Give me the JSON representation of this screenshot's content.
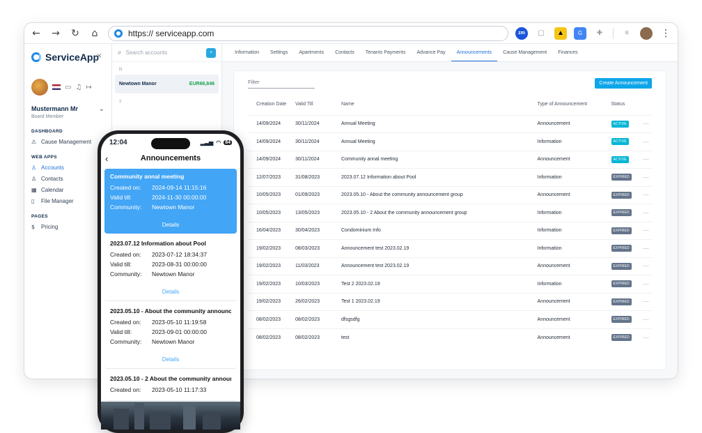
{
  "browser": {
    "url": "https:// serviceapp.com",
    "nav": {
      "back": "←",
      "forward": "→",
      "reload": "↻",
      "home": "⌂"
    }
  },
  "sidebar": {
    "brand": "ServiceApp",
    "close": "×",
    "user": {
      "name": "Mustermann Mr",
      "role": "Board Member"
    },
    "sections": [
      {
        "title": "DASHBOARD",
        "items": [
          {
            "label": "Cause Management",
            "icon": "warning-icon",
            "glyph": "⚠"
          }
        ]
      },
      {
        "title": "WEB APPS",
        "items": [
          {
            "label": "Accounts",
            "icon": "user-icon",
            "glyph": "♙"
          },
          {
            "label": "Contacts",
            "icon": "users-icon",
            "glyph": "♙"
          },
          {
            "label": "Calendar",
            "icon": "calendar-icon",
            "glyph": "▦"
          },
          {
            "label": "File Manager",
            "icon": "file-icon",
            "glyph": "▯"
          }
        ]
      },
      {
        "title": "PAGES",
        "items": [
          {
            "label": "Pricing",
            "icon": "dollar-icon",
            "glyph": "$"
          }
        ]
      }
    ]
  },
  "accounts": {
    "search_placeholder": "Search accounts",
    "letter_n": "N",
    "letter_t": "T",
    "items": [
      {
        "name": "Newtown Manor",
        "amount": "EUR66,846"
      }
    ]
  },
  "tabs": [
    "Information",
    "Settings",
    "Apartments",
    "Contacts",
    "Tenants Payments",
    "Advance Pay",
    "Announcements",
    "Cause Management",
    "Finances"
  ],
  "active_tab": "Announcements",
  "panel": {
    "filter_label": "Filter",
    "create_button": "Create Announcement",
    "columns": [
      "Creation Date",
      "Valid Till",
      "Name",
      "Type of Announcement",
      "Status"
    ],
    "rows": [
      {
        "created": "14/09/2024",
        "valid": "30/11/2024",
        "name": "Annual Meeting",
        "type": "Announcement",
        "status": "ACTIVE"
      },
      {
        "created": "14/09/2024",
        "valid": "30/11/2024",
        "name": "Annual Meeting",
        "type": "Information",
        "status": "ACTIVE"
      },
      {
        "created": "14/09/2024",
        "valid": "30/11/2024",
        "name": "Community annal meeting",
        "type": "Announcement",
        "status": "ACTIVE"
      },
      {
        "created": "12/07/2023",
        "valid": "31/08/2023",
        "name": "2023.07.12 Information about Pool",
        "type": "Information",
        "status": "EXPIRED"
      },
      {
        "created": "10/05/2023",
        "valid": "01/09/2023",
        "name": "2023.05.10 - About the community announcement group",
        "type": "Announcement",
        "status": "EXPIRED"
      },
      {
        "created": "10/05/2023",
        "valid": "13/05/2023",
        "name": "2023.05.10 - 2 About the community announcement group",
        "type": "Information",
        "status": "EXPIRED"
      },
      {
        "created": "16/04/2023",
        "valid": "30/04/2023",
        "name": "Condominium Info",
        "type": "Information",
        "status": "EXPIRED"
      },
      {
        "created": "19/02/2023",
        "valid": "08/03/2023",
        "name": "Announcement test 2023.02.19",
        "type": "Information",
        "status": "EXPIRED"
      },
      {
        "created": "19/02/2023",
        "valid": "11/03/2023",
        "name": "Announcement test 2023.02.19",
        "type": "Announcement",
        "status": "EXPIRED"
      },
      {
        "created": "19/02/2023",
        "valid": "10/03/2023",
        "name": "Test 2 2023.02.19",
        "type": "Information",
        "status": "EXPIRED"
      },
      {
        "created": "19/02/2023",
        "valid": "26/02/2023",
        "name": "Test 1 2023.02.19",
        "type": "Announcement",
        "status": "EXPIRED"
      },
      {
        "created": "08/02/2023",
        "valid": "08/02/2023",
        "name": "dfsgsdfg",
        "type": "Announcement",
        "status": "EXPIRED"
      },
      {
        "created": "08/02/2023",
        "valid": "08/02/2023",
        "name": "test",
        "type": "Announcement",
        "status": "EXPIRED"
      }
    ],
    "more": "···"
  },
  "phone": {
    "time": "12:04",
    "battery": "84",
    "title": "Announcements",
    "labels": {
      "created": "Created on:",
      "valid": "Valid till:",
      "community": "Community:",
      "details": "Details"
    },
    "cards": [
      {
        "title": "Community annal meeting",
        "created": "2024-09-14 11:15:16",
        "valid": "2024-11-30 00:00:00",
        "community": "Newtown Manor"
      },
      {
        "title": "2023.07.12 Information about Pool",
        "created": "2023-07-12 18:34:37",
        "valid": "2023-08-31 00:00:00",
        "community": "Newtown Manor"
      },
      {
        "title": "2023.05.10 - About the community announce...",
        "created": "2023-05-10 11:19:58",
        "valid": "2023-09-01 00:00:00",
        "community": "Newtown Manor"
      },
      {
        "title": "2023.05.10 - 2 About the community announ...",
        "created": "2023-05-10 11:17:33"
      }
    ]
  },
  "colors": {
    "accent": "#1e6fd9",
    "highlight_card": "#42a5f5",
    "active_badge": "#06b6d4",
    "expired_badge": "#64748b"
  }
}
